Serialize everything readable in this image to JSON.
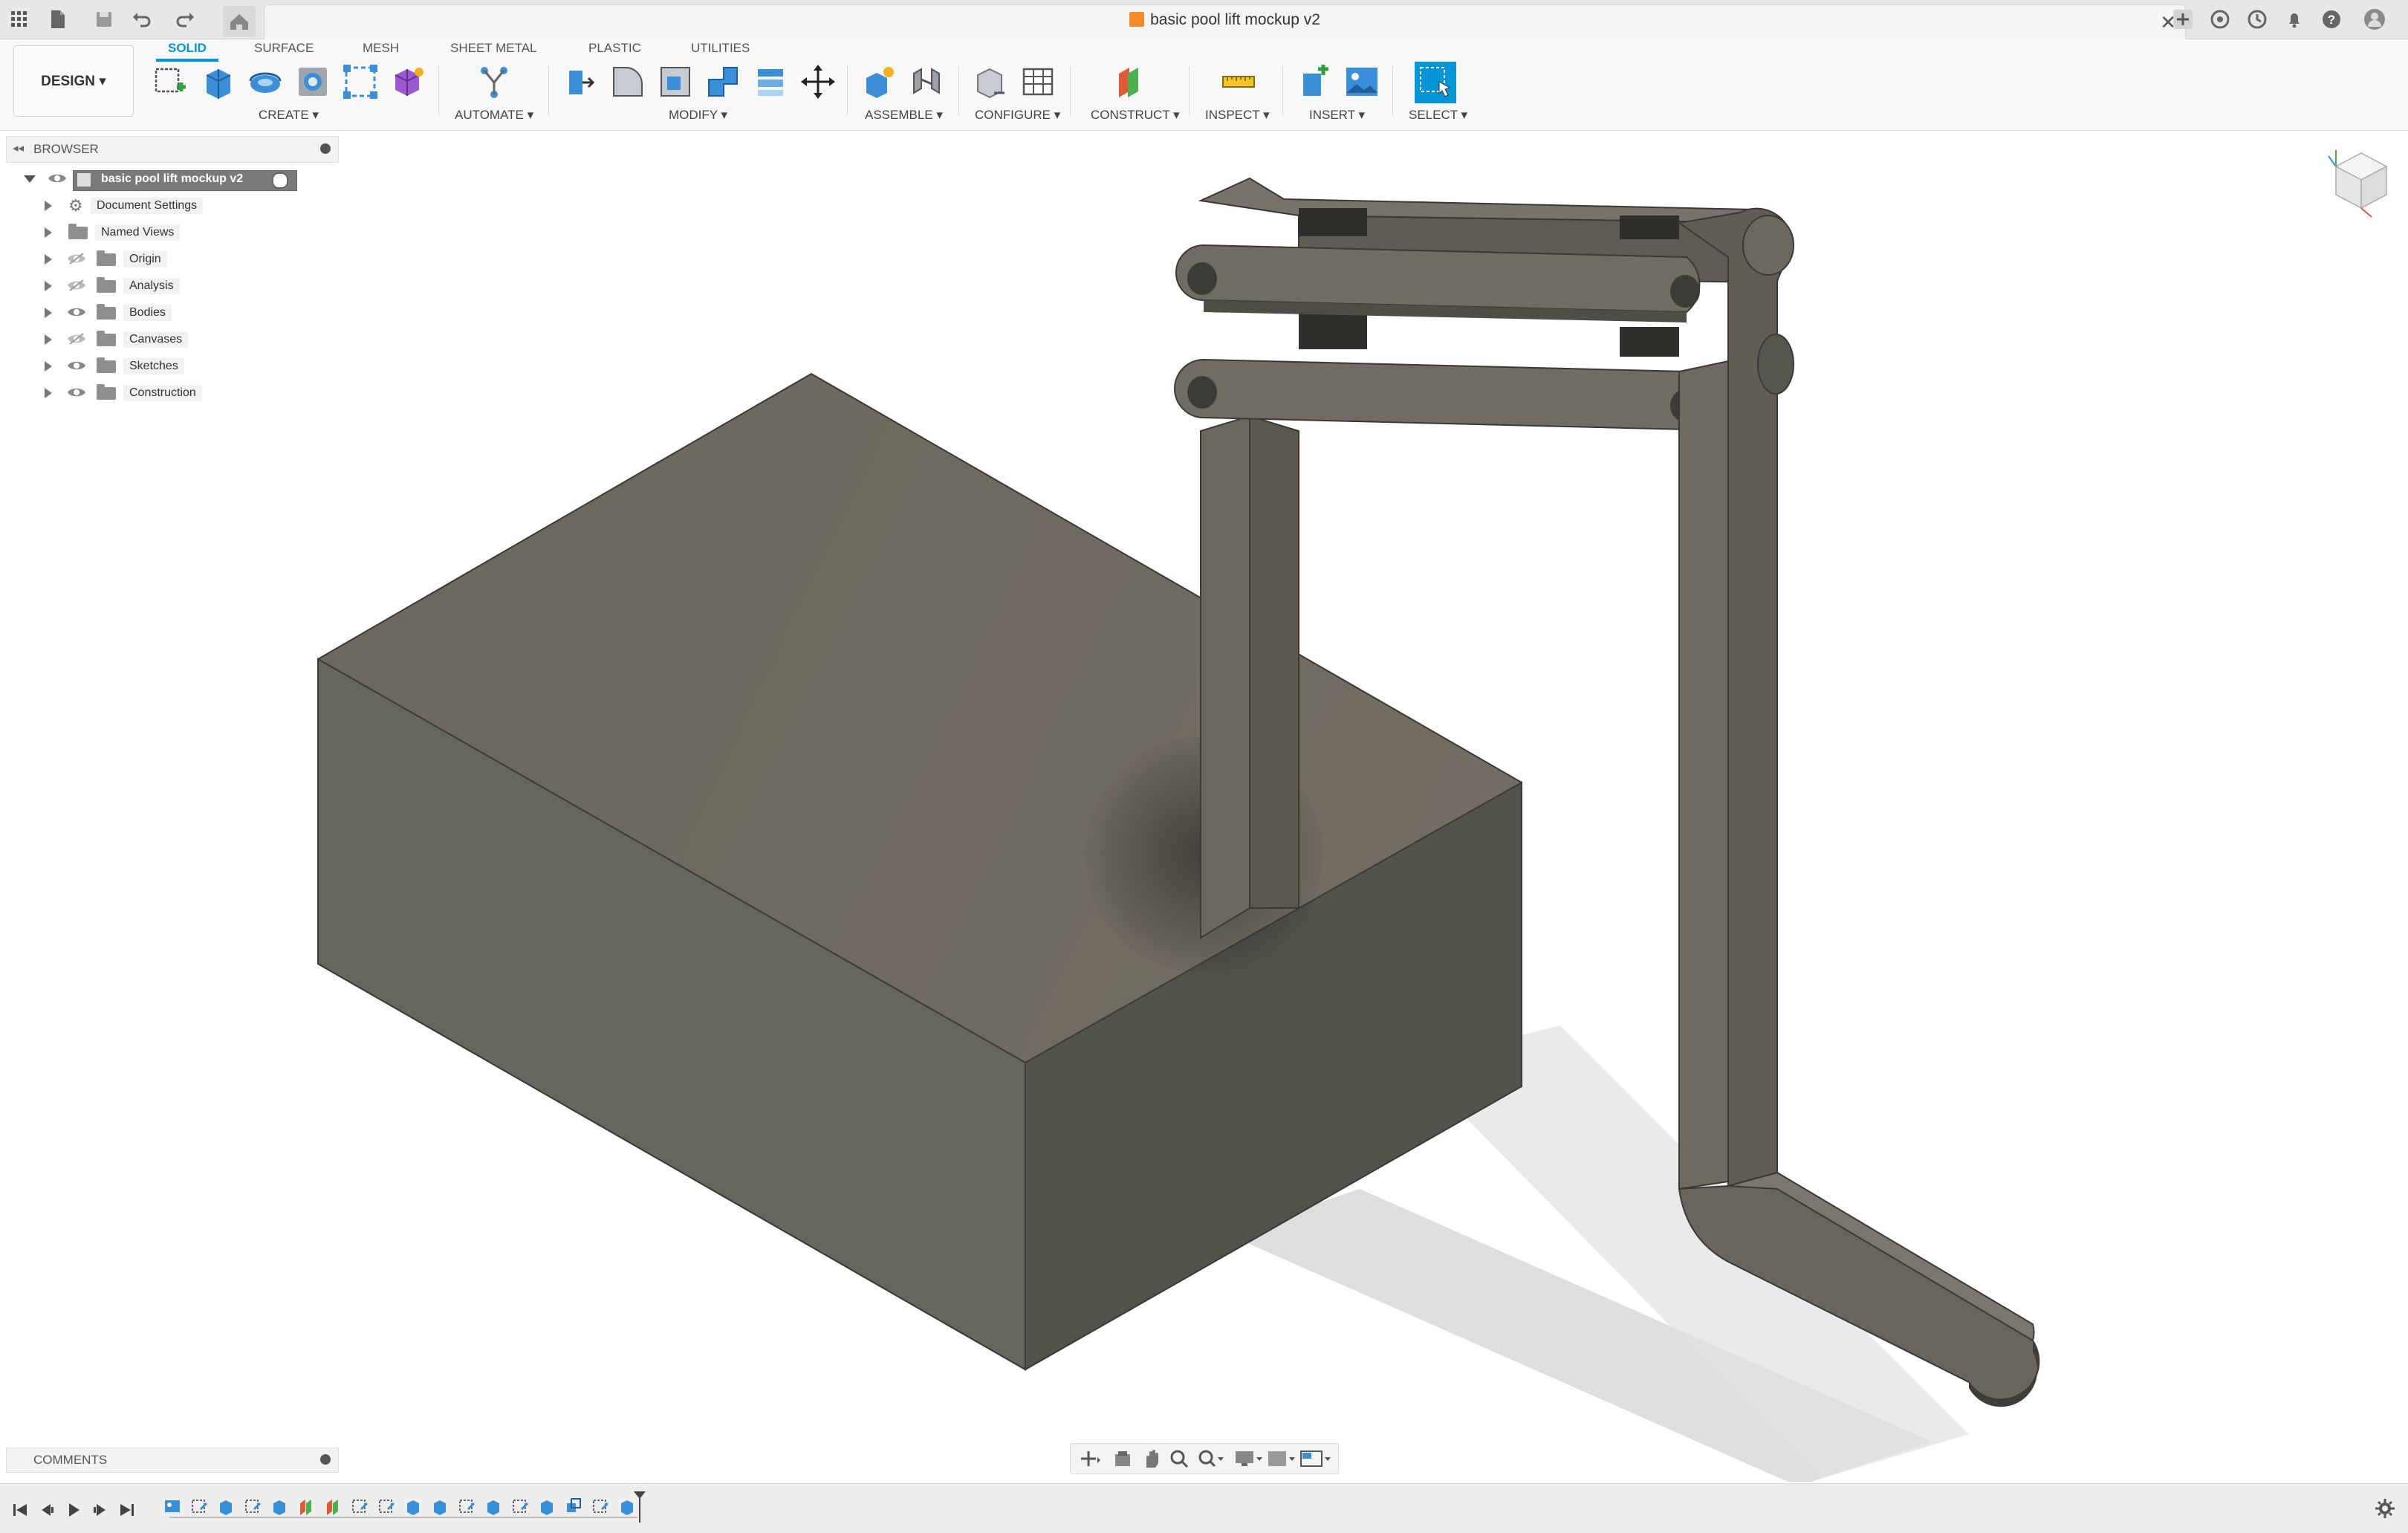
{
  "title_bar": {
    "document_title": "basic pool lift mockup v2",
    "icons": [
      "grid-icon",
      "file-icon",
      "save-icon",
      "undo-icon",
      "redo-icon",
      "home-icon",
      "close-icon",
      "add-tab-icon",
      "extensions-icon",
      "job-status-icon",
      "notifications-icon",
      "help-icon",
      "profile-icon"
    ]
  },
  "ribbon": {
    "workspace_label": "DESIGN ▾",
    "tabs": [
      {
        "label": "SOLID",
        "active": true
      },
      {
        "label": "SURFACE",
        "active": false
      },
      {
        "label": "MESH",
        "active": false
      },
      {
        "label": "SHEET METAL",
        "active": false
      },
      {
        "label": "PLASTIC",
        "active": false
      },
      {
        "label": "UTILITIES",
        "active": false
      }
    ],
    "groups": [
      {
        "label": "CREATE ▾"
      },
      {
        "label": "AUTOMATE ▾"
      },
      {
        "label": "MODIFY ▾"
      },
      {
        "label": "ASSEMBLE ▾"
      },
      {
        "label": "CONFIGURE ▾"
      },
      {
        "label": "CONSTRUCT ▾"
      },
      {
        "label": "INSPECT ▾"
      },
      {
        "label": "INSERT ▾"
      },
      {
        "label": "SELECT ▾"
      }
    ]
  },
  "browser": {
    "header_label": "BROWSER",
    "root_label": "basic pool lift mockup v2",
    "items": [
      {
        "label": "Document Settings"
      },
      {
        "label": "Named Views"
      },
      {
        "label": "Origin"
      },
      {
        "label": "Analysis"
      },
      {
        "label": "Bodies"
      },
      {
        "label": "Canvases"
      },
      {
        "label": "Sketches"
      },
      {
        "label": "Construction"
      }
    ]
  },
  "comments": {
    "label": "COMMENTS"
  },
  "colors": {
    "accent": "#0696d7",
    "body_top": "#6f6b60",
    "body_side": "#5a5850",
    "body_dark": "#4b4a44"
  }
}
